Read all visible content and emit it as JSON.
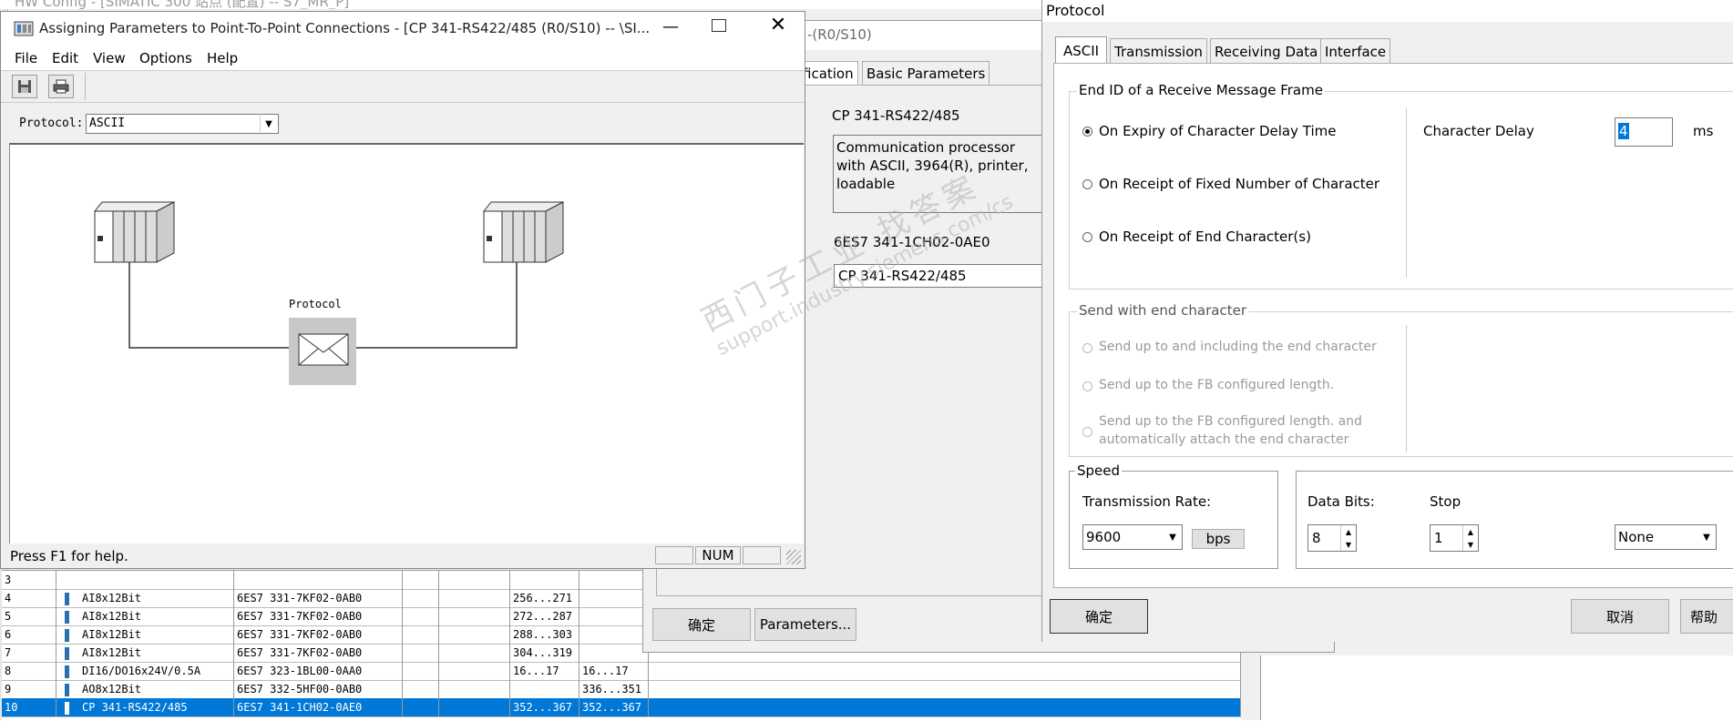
{
  "hwconfig": {
    "title": "HW Config - [SIMATIC 300 站点 (配置) -- S7_MR_P]",
    "rows": [
      {
        "slot": "3",
        "module": "",
        "order": "",
        "i": "",
        "q": ""
      },
      {
        "slot": "4",
        "module": "AI8x12Bit",
        "order": "6ES7 331-7KF02-0AB0",
        "i": "256...271",
        "q": ""
      },
      {
        "slot": "5",
        "module": "AI8x12Bit",
        "order": "6ES7 331-7KF02-0AB0",
        "i": "272...287",
        "q": ""
      },
      {
        "slot": "6",
        "module": "AI8x12Bit",
        "order": "6ES7 331-7KF02-0AB0",
        "i": "288...303",
        "q": ""
      },
      {
        "slot": "7",
        "module": "AI8x12Bit",
        "order": "6ES7 331-7KF02-0AB0",
        "i": "304...319",
        "q": ""
      },
      {
        "slot": "8",
        "module": "DI16/DO16x24V/0.5A",
        "order": "6ES7 323-1BL00-0AA0",
        "i": "16...17",
        "q": "16...17"
      },
      {
        "slot": "9",
        "module": "AO8x12Bit",
        "order": "6ES7 332-5HF00-0AB0",
        "i": "",
        "q": "336...351"
      },
      {
        "slot": "10",
        "module": "CP 341-RS422/485",
        "order": "6ES7 341-1CH02-0AE0",
        "i": "352...367",
        "q": "352...367"
      }
    ]
  },
  "props": {
    "title_suffix": "-(R0/S10)",
    "tabs": [
      "fication",
      "Basic Parameters"
    ],
    "module_name": "CP 341-RS422/485",
    "description": "Communication processor with ASCII, 3964(R), printer, loadable",
    "order_number": "6ES7 341-1CH02-0AE0",
    "name_value": "CP 341-RS422/485",
    "ok_label": "确定",
    "params_label": "Parameters..."
  },
  "assign": {
    "title": "Assigning Parameters to Point-To-Point Connections - [CP 341-RS422/485  (R0/S10)  -- \\SI...",
    "menu": [
      "File",
      "Edit",
      "View",
      "Options",
      "Help"
    ],
    "protocol_label": "Protocol:",
    "protocol_value": "ASCII",
    "diagram_label": "Protocol",
    "status": "Press F1 for help.",
    "num": "NUM"
  },
  "protocol": {
    "title": "Protocol",
    "tabs": [
      "ASCII",
      "Transmission",
      "Receiving Data",
      "Interface"
    ],
    "end_id_legend": "End ID of a Receive Message Frame",
    "opt1": "On Expiry of Character Delay Time",
    "opt2": "On Receipt of Fixed Number of Character",
    "opt3": "On Receipt of End Character(s)",
    "char_delay_label": "Character Delay",
    "char_delay_value": "4",
    "char_delay_unit": "ms",
    "send_legend": "Send with end character",
    "send1": "Send up to and including the end character",
    "send2": "Send up to the FB configured length.",
    "send3a": "Send up to the FB configured length. and",
    "send3b": "automatically attach the end character",
    "speed_legend": "Speed",
    "rate_label": "Transmission Rate:",
    "rate_value": "9600",
    "bps": "bps",
    "data_bits_label": "Data Bits:",
    "data_bits_value": "8",
    "stop_label": "Stop",
    "stop_value": "1",
    "parity_value": "None",
    "ok": "确定",
    "cancel": "取消",
    "help": "帮助"
  },
  "watermark": {
    "line1": "西门子工业  找答案",
    "line2": "support.industry.siemens.com/cs"
  }
}
